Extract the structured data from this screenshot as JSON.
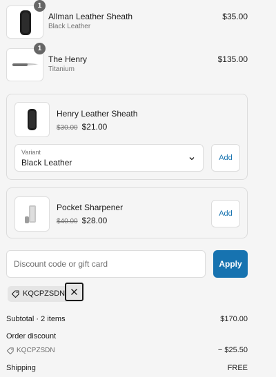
{
  "line_items": [
    {
      "title": "Allman Leather Sheath",
      "variant": "Black Leather",
      "price": "$35.00",
      "quantity": "1",
      "icon": "sheath-image"
    },
    {
      "title": "The Henry",
      "variant": "Titanium",
      "price": "$135.00",
      "quantity": "1",
      "icon": "knife-image"
    }
  ],
  "upsells": [
    {
      "title": "Henry Leather Sheath",
      "compare_price": "$30.00",
      "price": "$21.00",
      "variant_label": "Variant",
      "variant_value": "Black Leather",
      "add_label": "Add",
      "icon": "sheath-image"
    },
    {
      "title": "Pocket Sharpener",
      "compare_price": "$40.00",
      "price": "$28.00",
      "add_label": "Add",
      "icon": "sharpener-image"
    }
  ],
  "discount": {
    "placeholder": "Discount code or gift card",
    "apply_label": "Apply",
    "applied_code": "KQCPZSDN"
  },
  "summary": {
    "subtotal_label": "Subtotal · 2 items",
    "subtotal_value": "$170.00",
    "order_discount_label": "Order discount",
    "discount_code": "KQCPZSDN",
    "discount_value": "− $25.50",
    "shipping_label": "Shipping",
    "shipping_value": "FREE"
  },
  "colors": {
    "accent": "#1773b0",
    "background": "#f5f5f5",
    "badge": "#666666"
  }
}
